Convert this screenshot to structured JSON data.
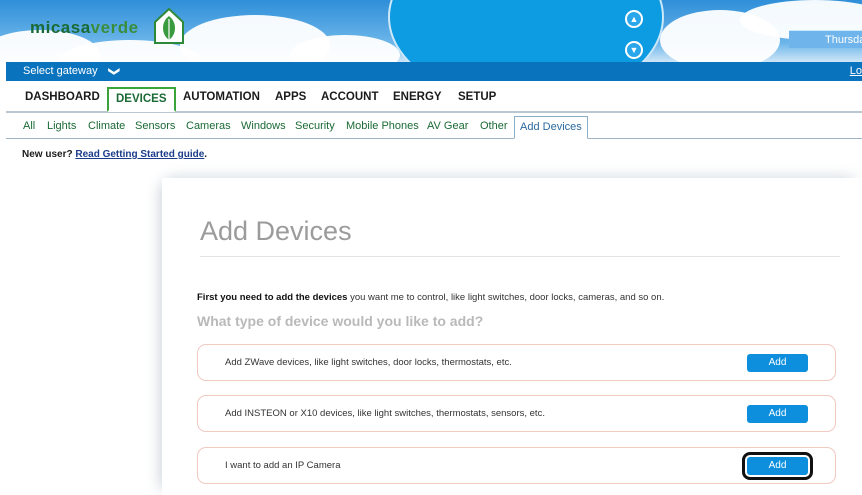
{
  "header": {
    "logo_text_1": "micasa",
    "logo_text_2": "verde",
    "date_text": "Thursda",
    "up_arrow": "▲",
    "down_arrow": "▼"
  },
  "gateway_bar": {
    "select_label": "Select gateway",
    "chevron": "❯",
    "logout": "Lo"
  },
  "main_tabs": [
    "DASHBOARD",
    "DEVICES",
    "AUTOMATION",
    "APPS",
    "ACCOUNT",
    "ENERGY",
    "SETUP"
  ],
  "sub_tabs": [
    "All",
    "Lights",
    "Climate",
    "Sensors",
    "Cameras",
    "Windows",
    "Security",
    "Mobile Phones",
    "AV Gear",
    "Other",
    "Add Devices"
  ],
  "new_user": {
    "label": "New user?",
    "link": "Read Getting Started guide"
  },
  "panel": {
    "title": "Add Devices",
    "intro_bold": "First you need to add the devices",
    "intro_rest": " you want me to control, like light switches, door locks, cameras, and so on.",
    "question": "What type of device would you like to add?",
    "options": [
      {
        "text": "Add ZWave devices, like light switches, door locks, thermostats, etc.",
        "button": "Add"
      },
      {
        "text": "Add INSTEON or X10 devices, like light switches, thermostats, sensors, etc.",
        "button": "Add"
      },
      {
        "text": "I want to add an IP Camera",
        "button": "Add"
      }
    ]
  },
  "colors": {
    "brand_green": "#1a6a35",
    "gateway_bar": "#0a73bd",
    "add_button": "#0d8fdd"
  }
}
